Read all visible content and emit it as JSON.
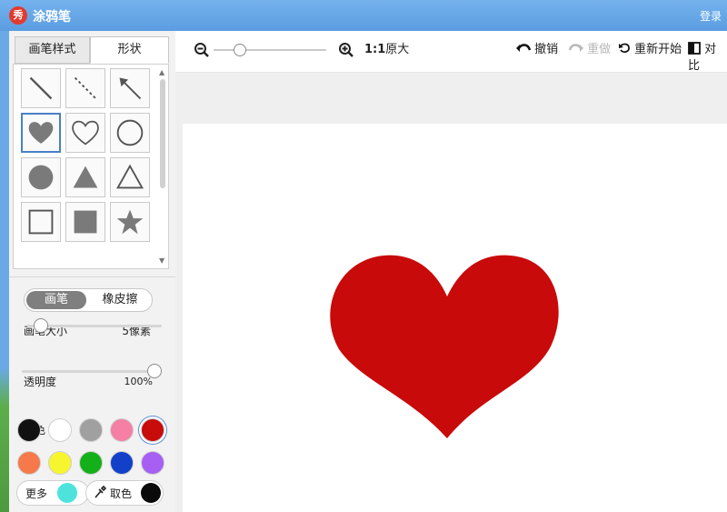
{
  "titlebar": {
    "logo_char": "秀",
    "title": "涂鸦笔",
    "login": "登录"
  },
  "left_panel": {
    "tabs": [
      {
        "label": "画笔样式"
      },
      {
        "label": "形状"
      }
    ],
    "shapes": [
      {
        "name": "line"
      },
      {
        "name": "dashed-line"
      },
      {
        "name": "arrow"
      },
      {
        "name": "heart-filled"
      },
      {
        "name": "heart-outline"
      },
      {
        "name": "circle-outline"
      },
      {
        "name": "circle-filled"
      },
      {
        "name": "triangle-filled"
      },
      {
        "name": "triangle-outline"
      },
      {
        "name": "square-outline"
      },
      {
        "name": "square-filled"
      },
      {
        "name": "star-filled"
      }
    ],
    "selected_shape": "heart-filled",
    "mode": {
      "pen_label": "画笔",
      "eraser_label": "橡皮擦",
      "active": "pen"
    },
    "brush_size": {
      "label": "画笔大小",
      "value_text": "5像素",
      "level": 0.05
    },
    "opacity": {
      "label": "透明度",
      "value_text": "100%",
      "level": 1.0
    },
    "color_label": "颜色",
    "colors": [
      "#111111",
      "#ffffff",
      "#a0a0a0",
      "#f57fa5",
      "#c80b0b",
      "#f5794a",
      "#f7f52e",
      "#14b01a",
      "#1240c8",
      "#a65ff2"
    ],
    "selected_color": "#c80b0b",
    "more_label": "更多",
    "more_color": "#4de3dc",
    "pick_label": "取色",
    "pick_color": "#0a0a0a"
  },
  "toolbar": {
    "zoom_level": 0.2,
    "actual_size_prefix": "1:1",
    "actual_size_label": "原大",
    "undo_label": "撤销",
    "redo_label": "重做",
    "restart_label": "重新开始",
    "compare_label": "对比"
  },
  "canvas": {
    "shape": "heart",
    "fill_color": "#c80a0a"
  }
}
